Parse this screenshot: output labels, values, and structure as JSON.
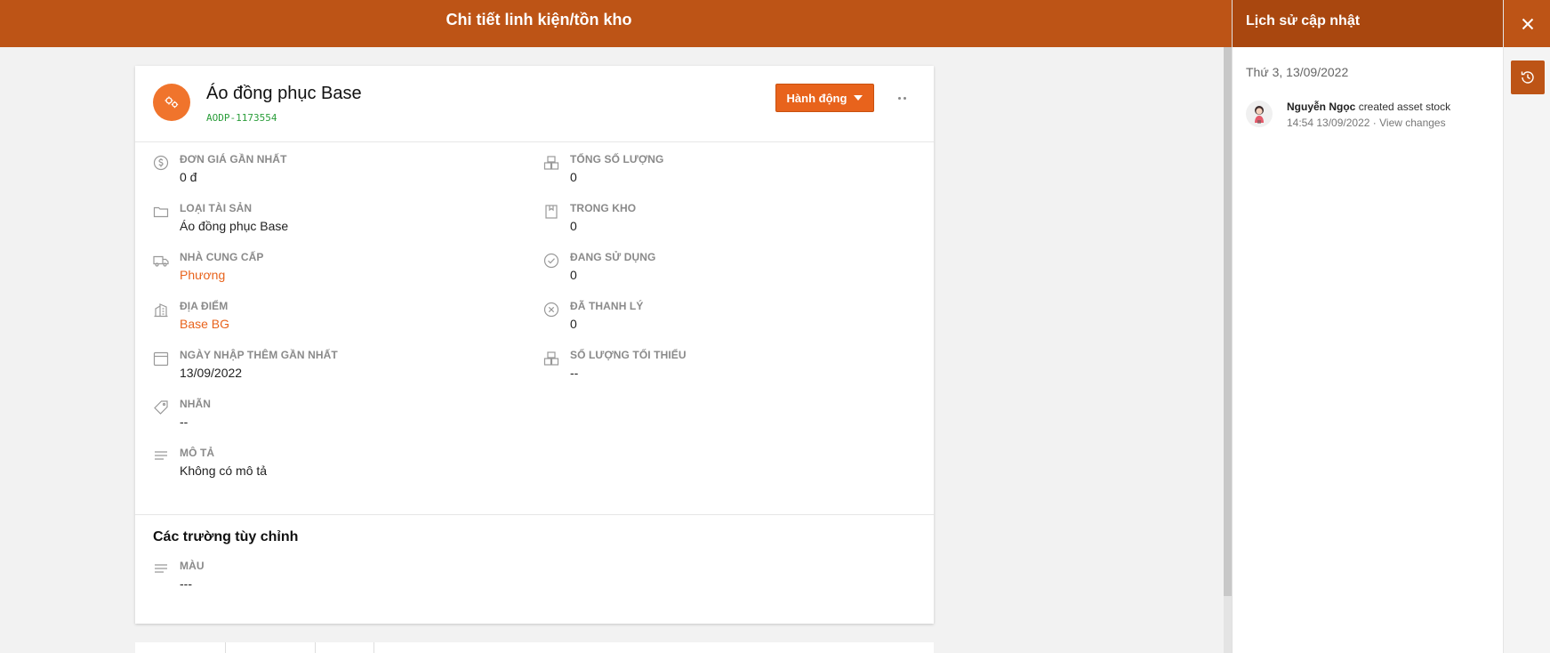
{
  "header": {
    "title": "Chi tiết linh kiện/tồn kho"
  },
  "asset": {
    "name": "Áo đồng phục Base",
    "code": "AODP-1173554",
    "action_label": "Hành động"
  },
  "fields_left": [
    {
      "label": "Đơn giá gần nhất",
      "value": "0 đ",
      "icon": "dollar-circle-icon"
    },
    {
      "label": "Loại tài sản",
      "value": "Áo đồng phục Base",
      "icon": "folder-icon"
    },
    {
      "label": "Nhà cung cấp",
      "value": "Phương",
      "icon": "truck-icon"
    },
    {
      "label": "Địa điểm",
      "value": "Base BG",
      "icon": "building-icon"
    },
    {
      "label": "Ngày nhập thêm gần nhất",
      "value": "13/09/2022",
      "icon": "calendar-icon"
    },
    {
      "label": "Nhãn",
      "value": "--",
      "icon": "tag-icon"
    },
    {
      "label": "Mô tả",
      "value": "Không có mô tả",
      "icon": "lines-icon"
    }
  ],
  "fields_right": [
    {
      "label": "Tổng số lượng",
      "value": "0",
      "icon": "boxes-icon"
    },
    {
      "label": "Trong kho",
      "value": "0",
      "icon": "bookmark-icon"
    },
    {
      "label": "Đang sử dụng",
      "value": "0",
      "icon": "check-circle-icon"
    },
    {
      "label": "Đã thanh lý",
      "value": "0",
      "icon": "x-circle-icon"
    },
    {
      "label": "Số lượng tối thiểu",
      "value": "--",
      "icon": "boxes-icon"
    }
  ],
  "custom_fields": {
    "title": "Các trường tùy chỉnh",
    "items": [
      {
        "label": "Màu",
        "value": "---",
        "icon": "lines-icon"
      }
    ]
  },
  "history": {
    "title": "Lịch sử cập nhật",
    "date": "Thứ 3, 13/09/2022",
    "entries": [
      {
        "user": "Nguyễn Ngọc",
        "action": "created asset stock",
        "time": "14:54 13/09/2022",
        "separator": "·",
        "link": "View changes"
      }
    ]
  },
  "colors": {
    "brand": "#bd5416",
    "accent": "#e8631c",
    "code_green": "#2a9d3a"
  }
}
